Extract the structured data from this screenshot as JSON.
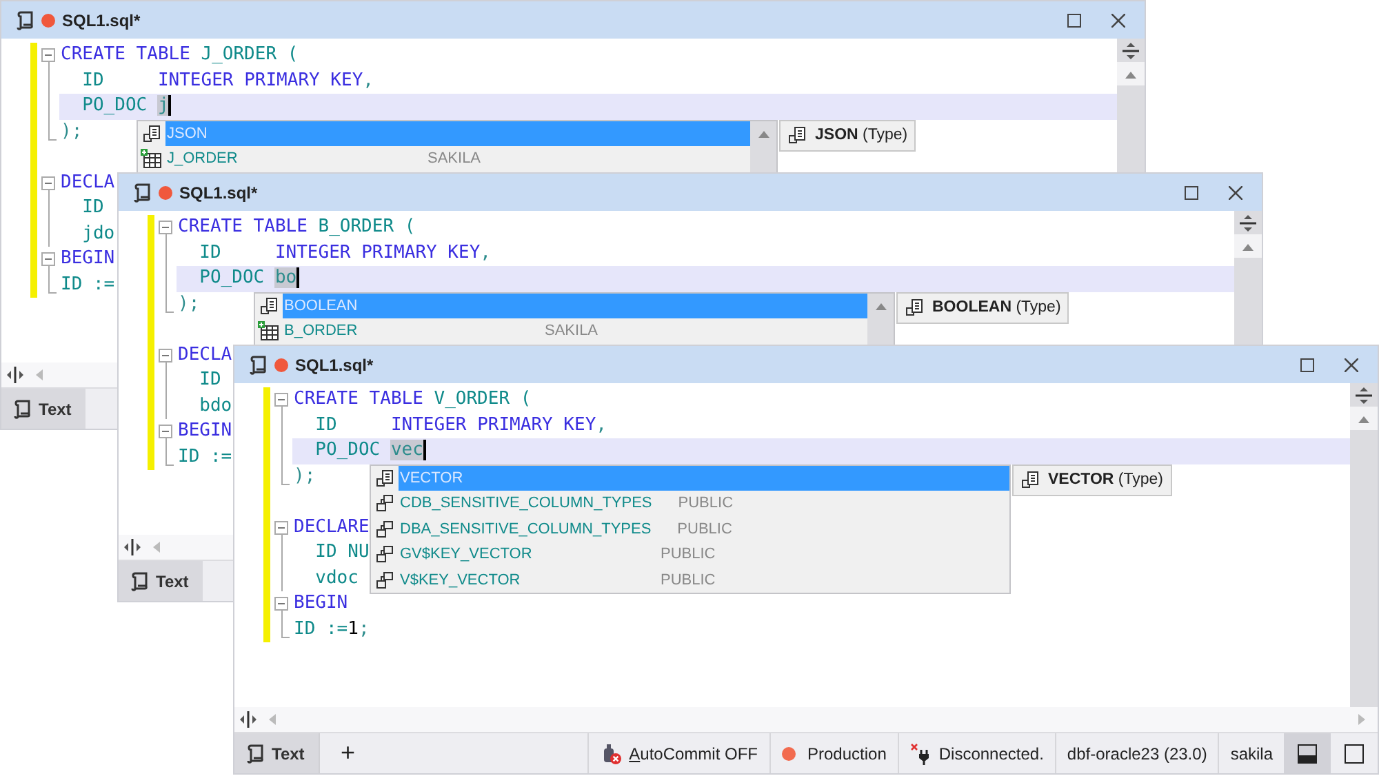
{
  "windows": [
    {
      "title": "SQL1.sql*",
      "modified": true,
      "lines": [
        {
          "kind": "block",
          "current": false,
          "tokens": [
            {
              "text": "CREATE TABLE",
              "kind": "kw"
            },
            {
              "text": " J_ORDER (",
              "kind": "id"
            }
          ]
        },
        {
          "kind": "body",
          "current": false,
          "tokens": [
            {
              "text": "  ID     ",
              "kind": "id"
            },
            {
              "text": "INTEGER PRIMARY KEY",
              "kind": "kw"
            },
            {
              "text": ",",
              "kind": "op"
            }
          ]
        },
        {
          "kind": "body",
          "current": true,
          "tokens": [
            {
              "text": "  PO_DOC ",
              "kind": "id"
            },
            {
              "text": "j",
              "kind": "typed"
            }
          ]
        },
        {
          "kind": "end",
          "current": false,
          "tokens": [
            {
              "text": ");",
              "kind": "op"
            }
          ]
        },
        {
          "kind": "blank",
          "current": false
        },
        {
          "kind": "block",
          "current": false,
          "tokens": [
            {
              "text": "DECLA",
              "kind": "kw"
            }
          ]
        },
        {
          "kind": "body",
          "current": false,
          "tokens": [
            {
              "text": "  ID",
              "kind": "id"
            }
          ]
        },
        {
          "kind": "body",
          "current": false,
          "tokens": [
            {
              "text": "  jdo",
              "kind": "id"
            }
          ]
        },
        {
          "kind": "block",
          "current": false,
          "tokens": [
            {
              "text": "BEGIN",
              "kind": "kw"
            }
          ]
        },
        {
          "kind": "end",
          "current": false,
          "tokens": [
            {
              "text": "ID :=",
              "kind": "id"
            }
          ]
        }
      ],
      "completion": {
        "scrollable": true,
        "items": [
          {
            "kind": "type",
            "name": "JSON",
            "selected": true
          },
          {
            "kind": "table",
            "name": "J_ORDER",
            "schema": "SAKILA",
            "selected": false
          }
        ]
      },
      "tooltip": "**JSON** (Type)",
      "tabs": [
        {
          "label": "Text",
          "selected": true
        }
      ]
    },
    {
      "title": "SQL1.sql*",
      "modified": true,
      "lines": [
        {
          "kind": "block",
          "current": false,
          "tokens": [
            {
              "text": "CREATE TABLE",
              "kind": "kw"
            },
            {
              "text": " B_ORDER (",
              "kind": "id"
            }
          ]
        },
        {
          "kind": "body",
          "current": false,
          "tokens": [
            {
              "text": "  ID     ",
              "kind": "id"
            },
            {
              "text": "INTEGER PRIMARY KEY",
              "kind": "kw"
            },
            {
              "text": ",",
              "kind": "op"
            }
          ]
        },
        {
          "kind": "body",
          "current": true,
          "tokens": [
            {
              "text": "  PO_DOC ",
              "kind": "id"
            },
            {
              "text": "bo",
              "kind": "typed"
            }
          ]
        },
        {
          "kind": "end",
          "current": false,
          "tokens": [
            {
              "text": ");",
              "kind": "op"
            }
          ]
        },
        {
          "kind": "blank",
          "current": false
        },
        {
          "kind": "block",
          "current": false,
          "tokens": [
            {
              "text": "DECLA",
              "kind": "kw"
            }
          ]
        },
        {
          "kind": "body",
          "current": false,
          "tokens": [
            {
              "text": "  ID",
              "kind": "id"
            }
          ]
        },
        {
          "kind": "body",
          "current": false,
          "tokens": [
            {
              "text": "  bdo",
              "kind": "id"
            }
          ]
        },
        {
          "kind": "block",
          "current": false,
          "tokens": [
            {
              "text": "BEGIN",
              "kind": "kw"
            }
          ]
        },
        {
          "kind": "end",
          "current": false,
          "tokens": [
            {
              "text": "ID :=",
              "kind": "id"
            }
          ]
        }
      ],
      "completion": {
        "scrollable": true,
        "items": [
          {
            "kind": "type",
            "name": "BOOLEAN",
            "selected": true
          },
          {
            "kind": "table",
            "name": "B_ORDER",
            "schema": "SAKILA",
            "selected": false
          }
        ]
      },
      "tooltip": "**BOOLEAN** (Type)",
      "tabs": [
        {
          "label": "Text",
          "selected": true
        }
      ]
    },
    {
      "title": "SQL1.sql*",
      "modified": true,
      "lines": [
        {
          "kind": "block",
          "current": false,
          "tokens": [
            {
              "text": "CREATE TABLE",
              "kind": "kw"
            },
            {
              "text": " V_ORDER (",
              "kind": "id"
            }
          ]
        },
        {
          "kind": "body",
          "current": false,
          "tokens": [
            {
              "text": "  ID     ",
              "kind": "id"
            },
            {
              "text": "INTEGER PRIMARY KEY",
              "kind": "kw"
            },
            {
              "text": ",",
              "kind": "op"
            }
          ]
        },
        {
          "kind": "body",
          "current": true,
          "tokens": [
            {
              "text": "  PO_DOC ",
              "kind": "id"
            },
            {
              "text": "vec",
              "kind": "typed"
            }
          ]
        },
        {
          "kind": "end",
          "current": false,
          "tokens": [
            {
              "text": ");",
              "kind": "op"
            }
          ]
        },
        {
          "kind": "blank",
          "current": false
        },
        {
          "kind": "block",
          "current": false,
          "tokens": [
            {
              "text": "DECLARE",
              "kind": "kw"
            }
          ]
        },
        {
          "kind": "body",
          "current": false,
          "tokens": [
            {
              "text": "  ID NU",
              "kind": "id"
            }
          ]
        },
        {
          "kind": "body",
          "current": false,
          "tokens": [
            {
              "text": "  vdoc",
              "kind": "id"
            }
          ]
        },
        {
          "kind": "block",
          "current": false,
          "tokens": [
            {
              "text": "BEGIN",
              "kind": "kw"
            }
          ]
        },
        {
          "kind": "end",
          "current": false,
          "tokens": [
            {
              "text": "ID :=",
              "kind": "id"
            },
            {
              "text": "1",
              "kind": "num"
            },
            {
              "text": ";",
              "kind": "op"
            }
          ]
        }
      ],
      "completion": {
        "scrollable": false,
        "items": [
          {
            "kind": "type",
            "name": "VECTOR",
            "selected": true
          },
          {
            "kind": "synonym",
            "name": "CDB_SENSITIVE_COLUMN_TYPES",
            "schema": "PUBLIC",
            "selected": false
          },
          {
            "kind": "synonym",
            "name": "DBA_SENSITIVE_COLUMN_TYPES",
            "schema": "PUBLIC",
            "selected": false
          },
          {
            "kind": "synonym",
            "name": "GV$KEY_VECTOR",
            "schema": "PUBLIC",
            "selected": false
          },
          {
            "kind": "synonym",
            "name": "V$KEY_VECTOR",
            "schema": "PUBLIC",
            "selected": false
          }
        ]
      },
      "tooltip": "**VECTOR** (Type)",
      "tabs": [
        {
          "label": "Text",
          "selected": true
        }
      ],
      "add_button": "+",
      "status_items": [
        {
          "kind": "autocommit",
          "text": "AutoCommit OFF"
        },
        {
          "kind": "environment",
          "text": "Production"
        },
        {
          "kind": "connection",
          "text": "Disconnected."
        },
        {
          "kind": "plain",
          "text": "dbf-oracle23 (23.0)"
        },
        {
          "kind": "plain",
          "text": "sakila"
        }
      ],
      "layout_buttons": [
        {
          "kind": "bottom-panel",
          "selected": true
        },
        {
          "kind": "single-panel",
          "selected": false
        }
      ]
    }
  ]
}
